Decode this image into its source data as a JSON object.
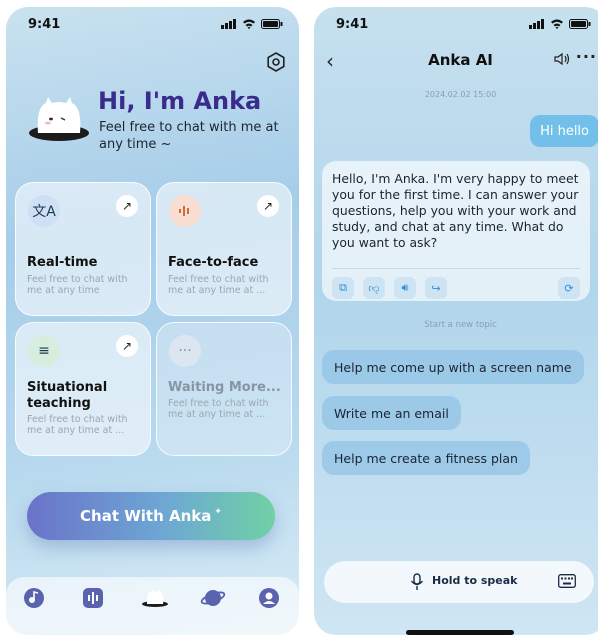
{
  "left_screen": {
    "status": {
      "time": "9:41"
    },
    "greeting": "Hi, I'm Anka",
    "subtitle": "Feel free to chat with me at any time ~",
    "cards": [
      {
        "title": "Real-time",
        "desc": "Feel free to chat with me at any time",
        "icon": "translate-icon",
        "icon_bg": "#cfe0f6"
      },
      {
        "title": "Face-to-face",
        "desc": "Feel free to chat with me at any time at ...",
        "icon": "voice-wave-icon",
        "icon_bg": "#f8dfd2"
      },
      {
        "title": "Situational teaching",
        "desc": "Feel free to chat with me at any time at ...",
        "icon": "list-icon",
        "icon_bg": "#d7eedf"
      },
      {
        "title": "Waiting More...",
        "desc": "Feel free to chat with me at any time at ...",
        "icon": "ellipsis-icon",
        "icon_bg": "#dbe6f1"
      }
    ],
    "cta_label": "Chat With Anka",
    "tabs": [
      "music-icon",
      "audio-icon",
      "mascot-icon",
      "planet-icon",
      "profile-icon"
    ]
  },
  "right_screen": {
    "status": {
      "time": "9:41"
    },
    "title": "Anka AI",
    "date": "2024.02.02 15:00",
    "user_message": "Hi hello",
    "ai_message": "Hello, I'm Anka. I'm very happy to meet you for the first time. I can answer your questions, help you with your work and study, and chat at any time. What do you want to ask?",
    "new_topic": "Start a new topic",
    "suggestions": [
      "Help me come up with a screen name",
      "Write me an email",
      "Help me create a fitness plan"
    ],
    "hold_to_speak": "Hold to speak"
  },
  "colors": {
    "accent": "#3a2c8c",
    "user_bubble": "#72c0ea",
    "cta_start": "#6a73c8",
    "cta_end": "#6fd1a4"
  }
}
